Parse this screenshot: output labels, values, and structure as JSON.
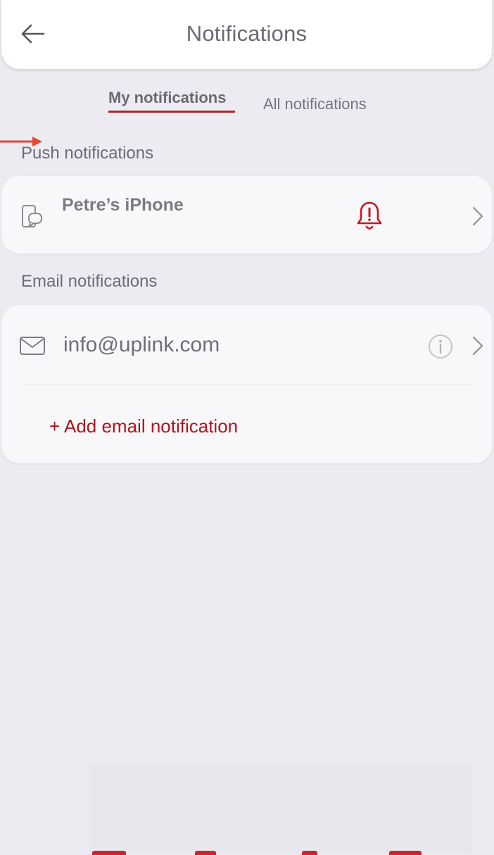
{
  "header": {
    "title": "Notifications",
    "back_icon": "arrow-left-icon"
  },
  "tabs": [
    {
      "label": "My notifications",
      "active": true
    },
    {
      "label": "All notifications",
      "active": false
    }
  ],
  "push": {
    "section_label": "Push notifications",
    "device": {
      "name": "Petre’s iPhone",
      "device_icon": "phone-icon",
      "alert_icon": "bell-alert-icon",
      "chevron_icon": "chevron-right-icon"
    }
  },
  "email": {
    "section_label": "Email notifications",
    "entries": [
      {
        "address": "info@uplink.com",
        "icon": "mail-icon",
        "info_icon": "info-icon",
        "chevron_icon": "chevron-right-icon"
      }
    ],
    "add_label": "+ Add email notification"
  },
  "colors": {
    "accent": "#b0141c",
    "background": "#ecebf2",
    "card": "#f8f8fa",
    "text_muted": "#6e6e76"
  }
}
